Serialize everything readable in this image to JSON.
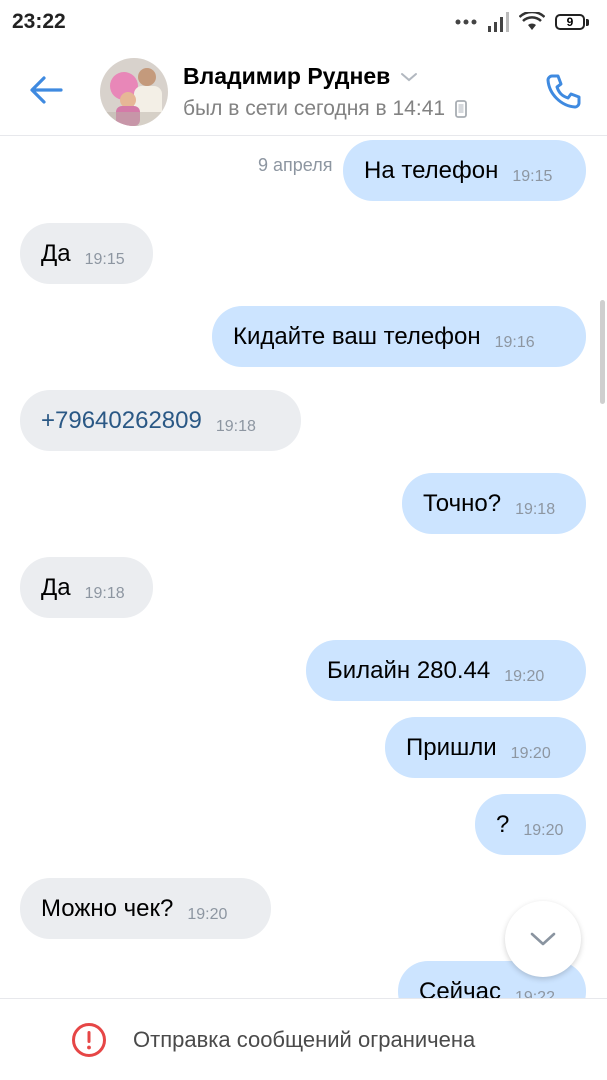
{
  "status_bar": {
    "time": "23:22",
    "battery": "9"
  },
  "header": {
    "contact_name": "Владимир Руднев",
    "last_seen": "был в сети сегодня в 14:41"
  },
  "messages": {
    "date_label": "9 апреля",
    "items": [
      {
        "dir": "out",
        "text": "На телефон",
        "time": "19:15"
      },
      {
        "dir": "in",
        "text": "Да",
        "time": "19:15"
      },
      {
        "dir": "out",
        "text": "Кидайте ваш телефон",
        "time": "19:16"
      },
      {
        "dir": "in",
        "text": "+79640262809",
        "time": "19:18",
        "is_link": true
      },
      {
        "dir": "out",
        "text": "Точно?",
        "time": "19:18"
      },
      {
        "dir": "in",
        "text": "Да",
        "time": "19:18"
      },
      {
        "dir": "out",
        "text": "Билайн 280.44",
        "time": "19:20"
      },
      {
        "dir": "out",
        "text": "Пришли",
        "time": "19:20"
      },
      {
        "dir": "out",
        "text": "?",
        "time": "19:20"
      },
      {
        "dir": "in",
        "text": "Можно чек?",
        "time": "19:20"
      },
      {
        "dir": "out",
        "text": "Сейчас",
        "time": "19:22"
      }
    ]
  },
  "footer": {
    "restriction_text": "Отправка сообщений ограничена"
  },
  "colors": {
    "accent": "#3f8ae0",
    "incoming_bubble": "#ebedf0",
    "outgoing_bubble": "#cce4ff",
    "link": "#2a5885",
    "error": "#e64646"
  },
  "icons": {
    "back": "back-arrow-icon",
    "call": "phone-icon",
    "dropdown": "chevron-down-icon",
    "device": "mobile-device-icon",
    "scroll_down": "chevron-down-icon",
    "restriction": "exclamation-circle-icon"
  }
}
